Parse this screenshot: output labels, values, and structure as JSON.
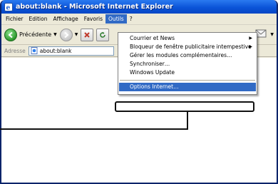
{
  "window": {
    "title": "about:blank - Microsoft Internet Explorer"
  },
  "menubar": {
    "items": [
      "Fichier",
      "Edition",
      "Affichage",
      "Favoris",
      "Outils",
      "?"
    ],
    "active_index": 4
  },
  "toolbar": {
    "back_label": "Précédente"
  },
  "addressbar": {
    "label": "Adresse",
    "value": "about:blank"
  },
  "tools_menu": {
    "items": [
      {
        "label": "Courrier et News",
        "has_submenu": true
      },
      {
        "label": "Bloqueur de fenêtre publicitaire intempestive",
        "has_submenu": true
      },
      {
        "label": "Gérer les modules complémentaires…",
        "has_submenu": false
      },
      {
        "label": "Synchroniser…",
        "has_submenu": false
      },
      {
        "label": "Windows Update",
        "has_submenu": false
      }
    ],
    "highlighted_item": "Options Internet…"
  },
  "colors": {
    "titlebar": "#0b54d8",
    "selection": "#316ac5",
    "chrome": "#ece9d8"
  }
}
